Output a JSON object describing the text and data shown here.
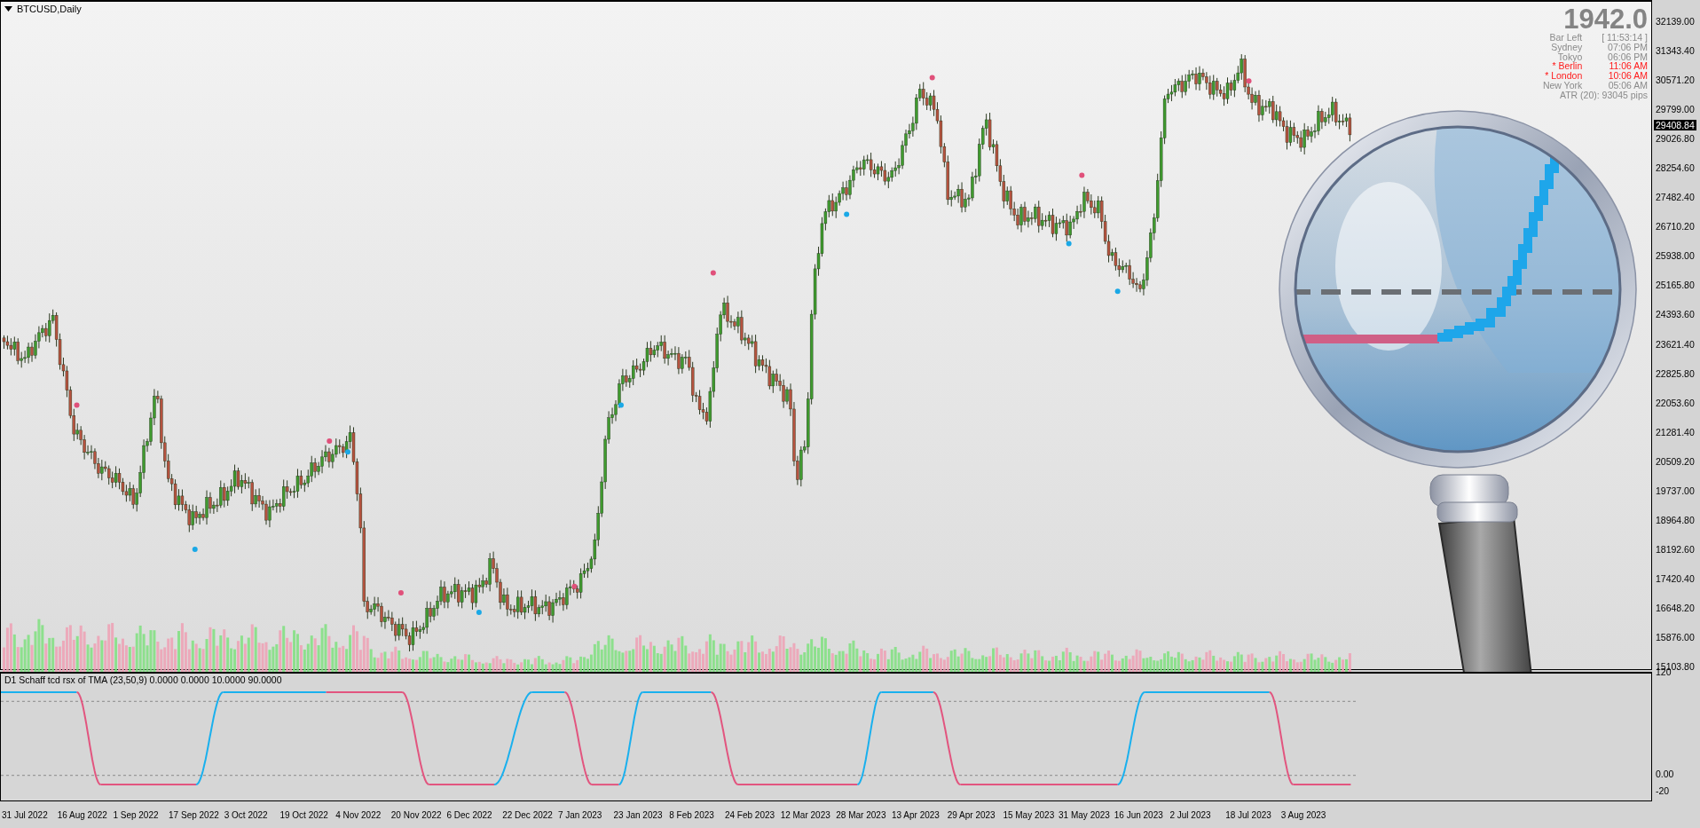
{
  "chart": {
    "symbol": "BTCUSD,Daily",
    "current_price": "29408.84",
    "price_axis": [
      "32139.00",
      "31343.40",
      "30571.20",
      "29799.00",
      "29026.80",
      "28254.60",
      "27482.40",
      "26710.20",
      "25938.00",
      "25165.80",
      "24393.60",
      "23621.40",
      "22825.80",
      "22053.60",
      "21281.40",
      "20509.20",
      "19737.00",
      "18964.80",
      "18192.60",
      "17420.40",
      "16648.20",
      "15876.00",
      "15103.80"
    ],
    "info_panel": {
      "value": "1942.0",
      "rows": [
        {
          "label": "Bar Left",
          "value": "[ 11:53:14 ]",
          "alert": false
        },
        {
          "label": "Sydney",
          "value": "07:06 PM",
          "alert": false
        },
        {
          "label": "Tokyo",
          "value": "06:06 PM",
          "alert": false
        },
        {
          "label": "* Berlin",
          "value": "11:06 AM",
          "alert": true
        },
        {
          "label": "* London",
          "value": "10:06 AM",
          "alert": true
        },
        {
          "label": "New York",
          "value": "05:06 AM",
          "alert": false
        }
      ],
      "atr": "ATR (20): 93045 pips"
    }
  },
  "indicator": {
    "title": "D1 Schaff tcd rsx of TMA (23,50,9) 0.0000 0.0000 10.0000 90.0000",
    "axis": [
      "120",
      "0.00",
      "-20"
    ]
  },
  "time_axis": [
    "31 Jul 2022",
    "16 Aug 2022",
    "1 Sep 2022",
    "17 Sep 2022",
    "3 Oct 2022",
    "19 Oct 2022",
    "4 Nov 2022",
    "20 Nov 2022",
    "6 Dec 2022",
    "22 Dec 2022",
    "7 Jan 2023",
    "23 Jan 2023",
    "8 Feb 2023",
    "24 Feb 2023",
    "12 Mar 2023",
    "28 Mar 2023",
    "13 Apr 2023",
    "29 Apr 2023",
    "15 May 2023",
    "31 May 2023",
    "16 Jun 2023",
    "2 Jul 2023",
    "18 Jul 2023",
    "3 Aug 2023"
  ]
}
